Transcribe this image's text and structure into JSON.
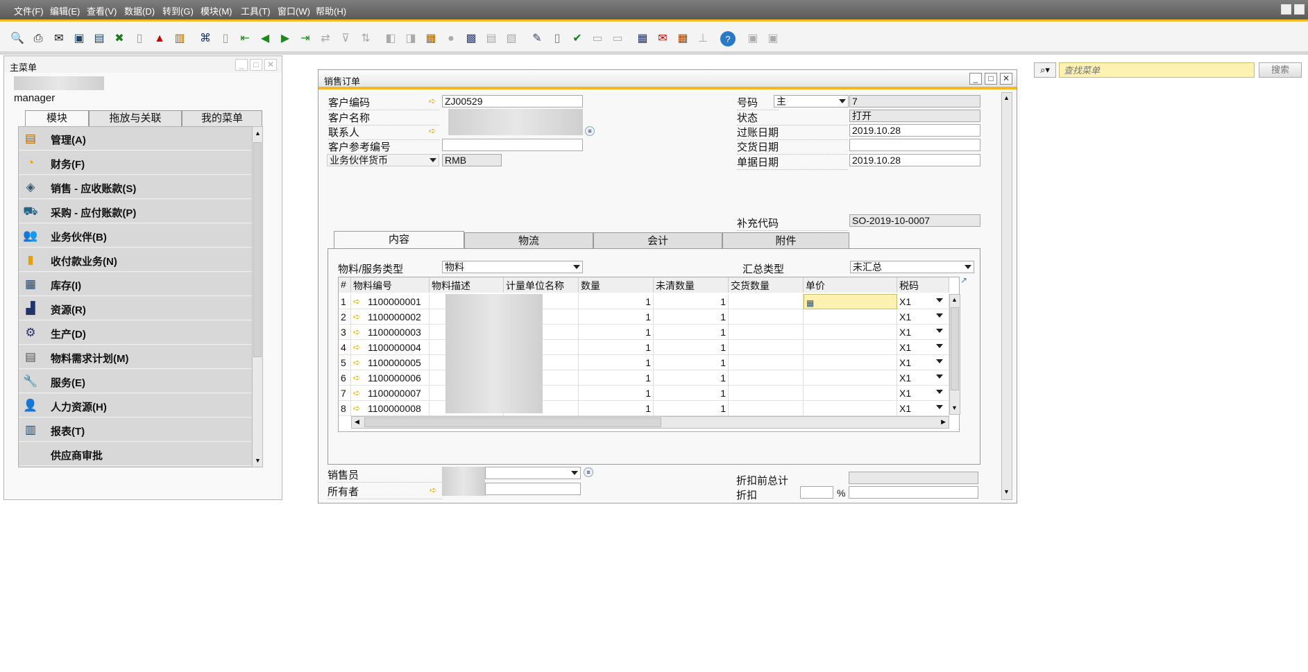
{
  "menubar": {
    "items": [
      "文件(F)",
      "编辑(E)",
      "查看(V)",
      "数据(D)",
      "转到(G)",
      "模块(M)",
      "工具(T)",
      "窗口(W)",
      "帮助(H)"
    ]
  },
  "search": {
    "placeholder": "查找菜单",
    "button": "搜索"
  },
  "colors": {
    "accent": "#f5b820",
    "menubar": "#5e5e5e",
    "arrow": "#e8a800",
    "highlight_cell": "#fdf2b2"
  },
  "main_menu": {
    "title": "主菜单",
    "user": "manager",
    "tabs": [
      "模块",
      "拖放与关联",
      "我的菜单"
    ],
    "items": [
      {
        "label": "管理(A)",
        "icon": "administration-icon"
      },
      {
        "label": "财务(F)",
        "icon": "finance-pie-icon"
      },
      {
        "label": "销售 - 应收账款(S)",
        "icon": "sales-icon"
      },
      {
        "label": "采购 - 应付账款(P)",
        "icon": "cart-icon"
      },
      {
        "label": "业务伙伴(B)",
        "icon": "partners-icon"
      },
      {
        "label": "收付款业务(N)",
        "icon": "banking-icon"
      },
      {
        "label": "库存(I)",
        "icon": "inventory-icon"
      },
      {
        "label": "资源(R)",
        "icon": "resources-icon"
      },
      {
        "label": "生产(D)",
        "icon": "production-icon"
      },
      {
        "label": "物料需求计划(M)",
        "icon": "mrp-icon"
      },
      {
        "label": "服务(E)",
        "icon": "service-icon"
      },
      {
        "label": "人力资源(H)",
        "icon": "hr-icon"
      },
      {
        "label": "报表(T)",
        "icon": "reports-icon"
      },
      {
        "label": "供应商审批",
        "icon": ""
      }
    ]
  },
  "sales_order": {
    "title": "销售订单",
    "customer_code_label": "客户编码",
    "customer_code": "ZJ00529",
    "customer_name_label": "客户名称",
    "contact_label": "联系人",
    "customer_ref_label": "客户参考编号",
    "customer_ref": "",
    "currency_label": "业务伙伴货币",
    "currency": "RMB",
    "number_label": "号码",
    "series": "主",
    "number": "7",
    "status_label": "状态",
    "status": "打开",
    "posting_date_label": "过账日期",
    "posting_date": "2019.10.28",
    "delivery_date_label": "交货日期",
    "delivery_date": "",
    "doc_date_label": "单据日期",
    "doc_date": "2019.10.28",
    "extra_code_label": "补充代码",
    "extra_code": "SO-2019-10-0007",
    "tabs": [
      "内容",
      "物流",
      "会计",
      "附件"
    ],
    "item_type_label": "物料/服务类型",
    "item_type": "物料",
    "summary_type_label": "汇总类型",
    "summary_type": "未汇总",
    "grid": {
      "headers": [
        "#",
        "物料编号",
        "物料描述",
        "计量单位名称",
        "数量",
        "未清数量",
        "交货数量",
        "单价",
        "税码"
      ],
      "rows": [
        {
          "n": "1",
          "code": "1100000001",
          "qty": "1",
          "open": "1",
          "tax": "X1"
        },
        {
          "n": "2",
          "code": "1100000002",
          "qty": "1",
          "open": "1",
          "tax": "X1"
        },
        {
          "n": "3",
          "code": "1100000003",
          "qty": "1",
          "open": "1",
          "tax": "X1"
        },
        {
          "n": "4",
          "code": "1100000004",
          "qty": "1",
          "open": "1",
          "tax": "X1"
        },
        {
          "n": "5",
          "code": "1100000005",
          "qty": "1",
          "open": "1",
          "tax": "X1"
        },
        {
          "n": "6",
          "code": "1100000006",
          "qty": "1",
          "open": "1",
          "tax": "X1"
        },
        {
          "n": "7",
          "code": "1100000007",
          "qty": "1",
          "open": "1",
          "tax": "X1"
        },
        {
          "n": "8",
          "code": "1100000008",
          "qty": "1",
          "open": "1",
          "tax": "X1"
        }
      ]
    },
    "salesperson_label": "销售员",
    "owner_label": "所有者",
    "total_before_discount_label": "折扣前总计",
    "discount_label": "折扣",
    "percent": "%"
  }
}
